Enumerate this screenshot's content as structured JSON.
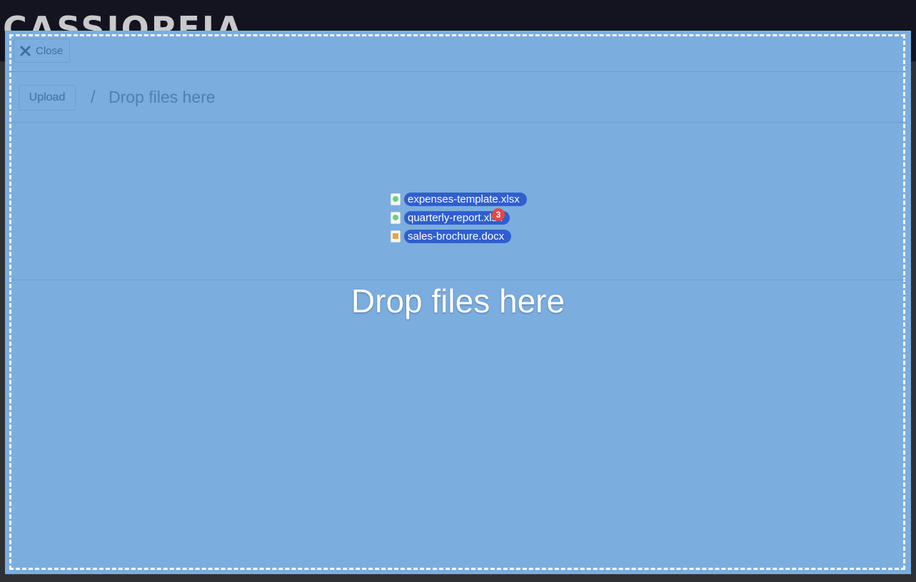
{
  "app": {
    "brand": "CASSIOPEIA"
  },
  "toolbar": {
    "close_label": "Close",
    "upload_label": "Upload"
  },
  "breadcrumb": {
    "separator": "/",
    "title": "Drop files here"
  },
  "drag": {
    "files": [
      {
        "name": "expenses-template.xlsx",
        "icon": "spreadsheet-file-icon"
      },
      {
        "name": "quarterly-report.xlsx",
        "icon": "spreadsheet-file-icon"
      },
      {
        "name": "sales-brochure.docx",
        "icon": "document-file-icon"
      }
    ],
    "count": "3"
  },
  "dropzone": {
    "message": "Drop files here"
  },
  "colors": {
    "overlay": "#7baddf",
    "pill": "#2f5fcf",
    "badge": "#e64646",
    "topbar": "#13141f"
  }
}
